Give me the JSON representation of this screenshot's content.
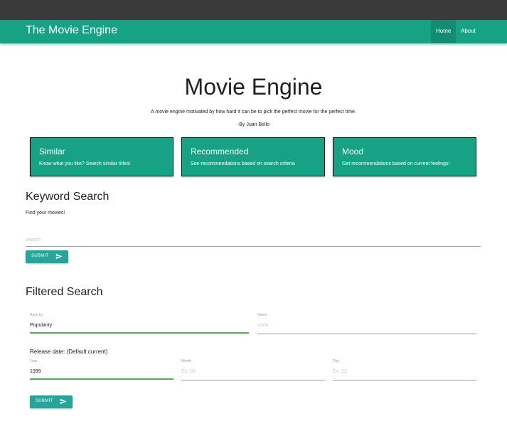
{
  "navbar": {
    "brand": "The Movie Engine",
    "links": [
      {
        "label": "Home",
        "active": true
      },
      {
        "label": "About",
        "active": false
      }
    ],
    "color": "#16a385"
  },
  "hero": {
    "title": "Movie Engine",
    "subtitle": "A movie engine motivated by how hard it can be to pick the perfect movie for the perfect time.",
    "author": "-By Juan Bello"
  },
  "cards": [
    {
      "title": "Similar",
      "text": "Know what you like? Search similar titles!"
    },
    {
      "title": "Recommended",
      "text": "See recommendations based on search criteria"
    },
    {
      "title": "Mood",
      "text": "Get recommendations based on current feelings!"
    }
  ],
  "keyword_search": {
    "title": "Keyword Search",
    "subtitle": "Find your movies!",
    "input_placeholder": "search",
    "input_value": "",
    "submit_label": "SUBMIT",
    "submit_icon": "send-icon"
  },
  "filtered_search": {
    "title": "Filtered Search",
    "rank_by": {
      "label": "Rank by",
      "value": "Popularity"
    },
    "genre": {
      "label": "Genre",
      "placeholder": "none"
    },
    "release_label": "Release date: (Default current)",
    "year": {
      "label": "Year",
      "value": "1999"
    },
    "month": {
      "label": "Month",
      "placeholder": "Ex: 03"
    },
    "day": {
      "label": "Day",
      "placeholder": "Ex: 23"
    },
    "submit_label": "SUBMIT",
    "submit_icon": "send-icon"
  },
  "colors": {
    "accent": "#16a385",
    "button": "#26a69a",
    "active_underline": "#4caf50"
  }
}
